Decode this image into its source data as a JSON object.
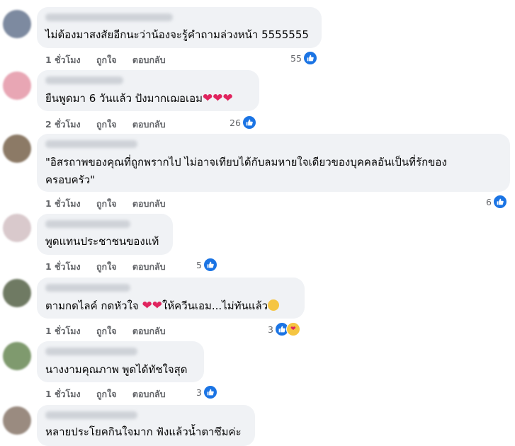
{
  "actions": {
    "like": "ถูกใจ",
    "reply": "ตอบกลับ"
  },
  "comments": [
    {
      "time": "1 ชั่วโมง",
      "text": "ไม่ต้องมาสงสัยอีกนะว่าน้องจะรู้คำถามล่วงหน้า 5555555",
      "reactions": "55",
      "avatar_color": "#7d8aa0"
    },
    {
      "time": "2 ชั่วโมง",
      "text": "ยืนพูดมา 6 วันแล้ว ปังมากเฌอเอม",
      "reactions": "26",
      "avatar_color": "#e8a6b4"
    },
    {
      "time": "1 ชั่วโมง",
      "text": "\"อิสรถาพของคุณที่ถูกพรากไป ไม่อาจเทียบได้กับลมหายใจเดียวของบุคคลอันเป็นที่รักของครอบครัว\"",
      "reactions": "6",
      "avatar_color": "#8c7a66"
    },
    {
      "time": "1 ชั่วโมง",
      "text": "พูดแทนประชาชนของแท้",
      "reactions": "5",
      "avatar_color": "#d9c9cc"
    },
    {
      "time": "1 ชั่วโมง",
      "text": "ตามกดไลค์ กดหัวใจ",
      "text_after": "ให้ควีนเอม...ไม่ทันแล้ว",
      "reactions": "3",
      "avatar_color": "#6f7a63"
    },
    {
      "time": "1 ชั่วโมง",
      "text": "นางงามคุณภาพ พูดได้ทัชใจสุด",
      "reactions": "3",
      "avatar_color": "#7f9a6e"
    },
    {
      "time": "",
      "text": "หลายประโยคกินใจมาก ฟังแล้วน้ำตาซึมค่ะ",
      "reactions": "",
      "avatar_color": "#9a8b80"
    }
  ]
}
